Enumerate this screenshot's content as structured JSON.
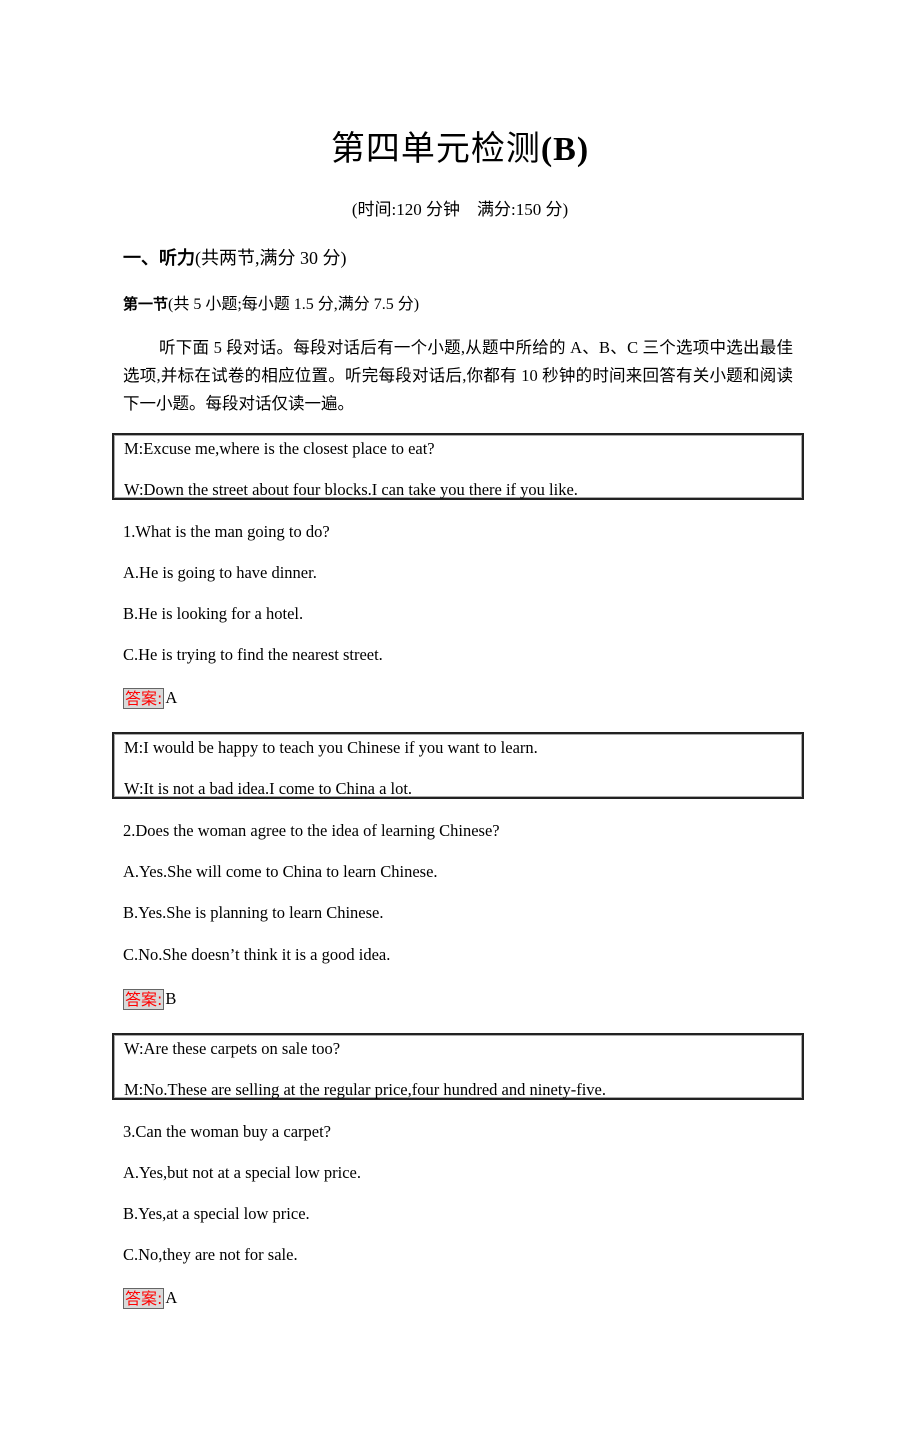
{
  "document": {
    "title_cn": "第四单元检测",
    "title_latin": "(B)",
    "subtitle": "(时间:120 分钟    满分:150 分)",
    "section": {
      "heading_strong": "一、听力",
      "heading_rest": "(共两节,满分 30 分)"
    },
    "part": {
      "heading_strong": "第一节",
      "heading_rest": "(共 5 小题;每小题 1.5 分,满分 7.5 分)"
    },
    "instructions": "听下面 5 段对话。每段对话后有一个小题,从题中所给的 A、B、C 三个选项中选出最佳选项,并标在试卷的相应位置。听完每段对话后,你都有 10 秒钟的时间来回答有关小题和阅读下一小题。每段对话仅读一遍。",
    "answer_label": "答案:",
    "questions": [
      {
        "dialog": [
          "M:Excuse me,where is the closest place to eat?",
          "W:Down the street about four blocks.I can take you there if you like."
        ],
        "question": "1.What is the man going to do?",
        "options": [
          "A.He is going to have dinner.",
          "B.He is looking for a hotel.",
          "C.He is trying to find the nearest street."
        ],
        "answer": "A"
      },
      {
        "dialog": [
          "M:I would be happy to teach you Chinese if you want to learn.",
          "W:It is not a bad idea.I come to China a lot."
        ],
        "question": "2.Does the woman agree to the idea of learning Chinese?",
        "options": [
          "A.Yes.She will come to China to learn Chinese.",
          "B.Yes.She is planning to learn Chinese.",
          "C.No.She doesn’t think it is a good idea."
        ],
        "answer": "B"
      },
      {
        "dialog": [
          "W:Are these carpets on sale too?",
          "M:No.These are selling at the regular price,four hundred and ninety-five."
        ],
        "question": "3.Can the woman buy a carpet?",
        "options": [
          "A.Yes,but not at a special low price.",
          "B.Yes,at a special low price.",
          "C.No,they are not for sale."
        ],
        "answer": "A"
      }
    ]
  }
}
